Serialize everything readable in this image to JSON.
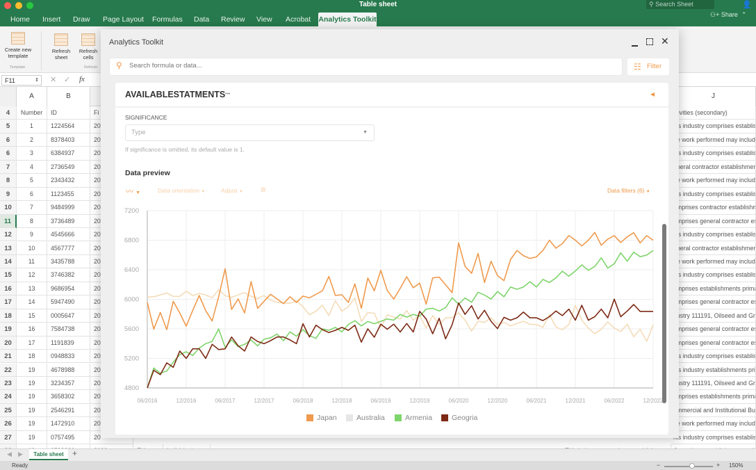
{
  "window": {
    "title": "Table sheet",
    "search_placeholder": "Search Sheet",
    "share_label": "Share"
  },
  "menu_tabs": [
    "Home",
    "Insert",
    "Draw",
    "Page Layout",
    "Formulas",
    "Data",
    "Review",
    "View",
    "Acrobat",
    "Analytics Toolkit"
  ],
  "active_tab": "Analytics Toolkit",
  "ribbon": {
    "create_template": "Create new template",
    "template_group": "Template",
    "refresh_sheet": "Refresh sheet",
    "refresh_cells": "Refresh cells",
    "refresh_group": "Refresh"
  },
  "formula_bar": {
    "name_box": "F11",
    "fx": "fx"
  },
  "sheet": {
    "columns": [
      "A",
      "B",
      "J"
    ],
    "partial_column_c_header": "Fi",
    "header_row": {
      "row": "4",
      "a": "Number",
      "b": "ID",
      "c": "Fi",
      "j": "ctivities (secondary)"
    },
    "rows": [
      {
        "row": "5",
        "a": "1",
        "b": "1224564",
        "c": "20",
        "j": "his industry comprises establish"
      },
      {
        "row": "6",
        "a": "2",
        "b": "8378403",
        "c": "20",
        "j": "he work performed may include"
      },
      {
        "row": "6",
        "a": "3",
        "b": "6384937",
        "c": "20",
        "j": "his industry comprises establish"
      },
      {
        "row": "7",
        "a": "4",
        "b": "2736549",
        "c": "20",
        "j": "eneral contractor establishmen"
      },
      {
        "row": "8",
        "a": "5",
        "b": "2343432",
        "c": "20",
        "j": "he work performed may include"
      },
      {
        "row": "9",
        "a": "6",
        "b": "1123455",
        "c": "20",
        "j": "his industry comprises establish"
      },
      {
        "row": "10",
        "a": "7",
        "b": "9484999",
        "c": "20",
        "j": "omprises  contractor establishm"
      },
      {
        "row": "11",
        "a": "8",
        "b": "3736489",
        "c": "20",
        "j": "omprises general contractor es"
      },
      {
        "row": "12",
        "a": "9",
        "b": "4545666",
        "c": "20",
        "j": "his industry comprises establish"
      },
      {
        "row": "13",
        "a": "10",
        "b": "4567777",
        "c": "20",
        "j": "eneral contractor establishmen"
      },
      {
        "row": "14",
        "a": "11",
        "b": "3435788",
        "c": "20",
        "j": "he work performed may include"
      },
      {
        "row": "15",
        "a": "12",
        "b": "3746382",
        "c": "20",
        "j": "his industry comprises establish"
      },
      {
        "row": "16",
        "a": "13",
        "b": "9686954",
        "c": "20",
        "j": "omprises establishments prima"
      },
      {
        "row": "17",
        "a": "14",
        "b": "5947490",
        "c": "20",
        "j": "omprises general contractor es"
      },
      {
        "row": "18",
        "a": "15",
        "b": "0005647",
        "c": "20",
        "j": "dustry 111191, Oilseed and Gra"
      },
      {
        "row": "19",
        "a": "16",
        "b": "7584738",
        "c": "20",
        "j": "omprises general contractor es"
      },
      {
        "row": "20",
        "a": "17",
        "b": "1191839",
        "c": "20",
        "j": "omprises general contractor es"
      },
      {
        "row": "21",
        "a": "18",
        "b": "0948833",
        "c": "20",
        "j": "his industry comprises establis"
      },
      {
        "row": "22",
        "a": "19",
        "b": "4678988",
        "c": "20",
        "j": "his industry establishments prin"
      },
      {
        "row": "23",
        "a": "19",
        "b": "3234357",
        "c": "20",
        "j": "dustry 111191, Oilseed and Gra"
      },
      {
        "row": "24",
        "a": "19",
        "b": "3658302",
        "c": "20",
        "j": "omprises establishments prima"
      },
      {
        "row": "25",
        "a": "19",
        "b": "2546291",
        "c": "20",
        "j": "ommercial and Institutional Bui"
      },
      {
        "row": "26",
        "a": "19",
        "b": "1472910",
        "c": "20",
        "j": "he work performed may include"
      },
      {
        "row": "27",
        "a": "19",
        "b": "0757495",
        "c": "20",
        "j": "his industry comprises establis"
      },
      {
        "row": "28",
        "a": "19",
        "b": "6522836",
        "c": "2022",
        "d": "FY",
        "e": "Individual",
        "i": "This industry comprises establishments p",
        "j": "Comprises establishments prima"
      }
    ],
    "selected_row": "11",
    "sheet_tab": "Table sheet",
    "status": "Ready",
    "zoom": "150%"
  },
  "dialog": {
    "title": "Analytics Toolkit",
    "search_placeholder": "Search formula or data...",
    "filter_label": "Filter",
    "section_title": "AVAILABLESTATMENTS",
    "more": "•••",
    "significance_label": "SIGNIFICANCE",
    "type_placeholder": "Type",
    "hint": "If significance is omitted, its default value is 1.",
    "preview_title": "Data preview",
    "data_orientation": "Data orientation",
    "adjust": "Adjust",
    "data_filters": "Data filters (6)"
  },
  "chart_data": {
    "type": "line",
    "ylim": [
      4800,
      7200
    ],
    "yticks": [
      "4800",
      "5200",
      "5600",
      "6000",
      "6400",
      "6800",
      "7200"
    ],
    "xticks": [
      "06/2016",
      "12/2016",
      "06/2017",
      "12/2017",
      "06/2018",
      "12/2018",
      "06/2019",
      "12/2019",
      "06/2020",
      "12/2020",
      "06/2021",
      "12/2021",
      "06/2022",
      "12/2022"
    ],
    "grid": true,
    "legend": "bottom",
    "x_start": "06/2016",
    "x_end": "12/2022",
    "x_frequency": "monthly",
    "series": [
      {
        "name": "Japan",
        "color": "#ef9a4d",
        "values": [
          5958,
          5596,
          5822,
          5590,
          5973,
          5816,
          5637,
          5848,
          6052,
          5848,
          5706,
          6036,
          6414,
          5863,
          6005,
          5816,
          6241,
          5879,
          5973,
          6068,
          6005,
          5942,
          6036,
          5958,
          6043,
          6020,
          6068,
          6115,
          6310,
          6052,
          6062,
          5958,
          6209,
          5879,
          6288,
          6115,
          6392,
          6120,
          6003,
          6150,
          6306,
          6157,
          6219,
          5935,
          6290,
          6300,
          6197,
          6089,
          6763,
          6445,
          6352,
          6621,
          6228,
          6516,
          6321,
          6253,
          6537,
          6661,
          6590,
          6553,
          6574,
          6661,
          6800,
          6692,
          6754,
          6862,
          6800,
          6723,
          6800,
          6905,
          6732,
          6815,
          6862,
          6769,
          6846,
          6902,
          6763,
          6862,
          6800
        ]
      },
      {
        "name": "Australia",
        "color": "#f4dcb9",
        "values": [
          6030,
          6035,
          6060,
          6085,
          6040,
          6040,
          6110,
          6050,
          6080,
          6060,
          6020,
          6130,
          6050,
          6025,
          6060,
          6090,
          6040,
          6010,
          6050,
          5990,
          5960,
          5950,
          5945,
          5980,
          5900,
          5790,
          5840,
          5920,
          5780,
          5980,
          5840,
          5900,
          6020,
          5700,
          5820,
          5810,
          5620,
          5790,
          5760,
          5734,
          5848,
          5718,
          5780,
          5610,
          5780,
          5657,
          5750,
          5750,
          5817,
          5718,
          5570,
          5703,
          5688,
          5750,
          5657,
          5688,
          5641,
          5672,
          5703,
          5663,
          5657,
          5620,
          5796,
          5626,
          5589,
          5657,
          5919,
          5718,
          5610,
          5533,
          5595,
          5694,
          5610,
          5564,
          5663,
          5493,
          5595,
          5431,
          5657
        ]
      },
      {
        "name": "Armenia",
        "color": "#7fd46b",
        "values": [
          4800,
          5070,
          5000,
          5030,
          5150,
          5250,
          5290,
          5240,
          5340,
          5400,
          5430,
          5600,
          5350,
          5450,
          5360,
          5390,
          5450,
          5370,
          5460,
          5480,
          5530,
          5440,
          5560,
          5500,
          5590,
          5510,
          5470,
          5600,
          5580,
          5620,
          5560,
          5660,
          5710,
          5640,
          5700,
          5670,
          5703,
          5734,
          5718,
          5796,
          5759,
          5796,
          5771,
          5867,
          5879,
          5842,
          5888,
          6021,
          5935,
          6018,
          5960,
          6096,
          6058,
          6003,
          6105,
          6034,
          6167,
          6136,
          6167,
          6238,
          6167,
          6269,
          6228,
          6290,
          6380,
          6312,
          6383,
          6466,
          6392,
          6445,
          6562,
          6423,
          6482,
          6630,
          6516,
          6639,
          6577,
          6599,
          6661
        ]
      },
      {
        "name": "Geogria",
        "color": "#7c2a15",
        "values": [
          4800,
          5040,
          4980,
          5140,
          5080,
          5300,
          5200,
          5330,
          5330,
          5200,
          5390,
          5320,
          5330,
          5490,
          5370,
          5300,
          5490,
          5430,
          5400,
          5440,
          5490,
          5490,
          5450,
          5400,
          5670,
          5490,
          5650,
          5590,
          5550,
          5580,
          5620,
          5580,
          5650,
          5420,
          5600,
          5487,
          5663,
          5595,
          5663,
          5558,
          5672,
          5558,
          5836,
          5734,
          5533,
          5743,
          5465,
          5657,
          5950,
          5796,
          5913,
          5734,
          5851,
          5703,
          5604,
          5756,
          5718,
          5750,
          5827,
          5750,
          5750,
          5712,
          5765,
          5842,
          5780,
          5867,
          5718,
          5919,
          5718,
          5765,
          5867,
          5750,
          6003,
          5765,
          5842,
          5929,
          5836,
          5836,
          5836
        ]
      }
    ]
  }
}
